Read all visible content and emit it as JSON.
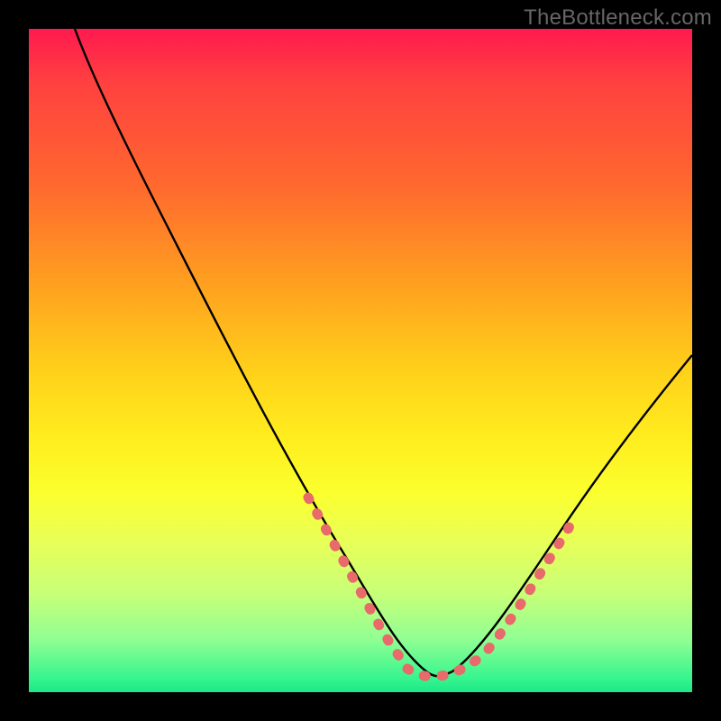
{
  "watermark": "TheBottleneck.com",
  "chart_data": {
    "type": "line",
    "title": "",
    "xlabel": "",
    "ylabel": "",
    "xlim": [
      0,
      100
    ],
    "ylim": [
      0,
      100
    ],
    "series": [
      {
        "name": "curve",
        "x": [
          7,
          12,
          20,
          30,
          40,
          48,
          52,
          56,
          58,
          60,
          62,
          65,
          70,
          80,
          90,
          100
        ],
        "y": [
          100,
          88,
          72,
          50,
          30,
          14,
          7,
          3,
          2,
          2,
          3,
          6,
          12,
          26,
          40,
          54
        ]
      },
      {
        "name": "dotted-segment-left",
        "x": [
          40,
          42,
          44,
          46,
          48,
          50,
          52,
          54,
          56
        ],
        "y": [
          30,
          26,
          22,
          18,
          14,
          10,
          7,
          5,
          3
        ]
      },
      {
        "name": "dotted-segment-bottom",
        "x": [
          56,
          58,
          60,
          62,
          64,
          66,
          68
        ],
        "y": [
          3,
          2,
          2,
          3,
          4,
          5,
          7
        ]
      },
      {
        "name": "dotted-segment-right",
        "x": [
          68,
          70,
          72,
          74,
          76,
          78,
          80
        ],
        "y": [
          9,
          12,
          15,
          18,
          21,
          24,
          26
        ]
      }
    ],
    "colors": {
      "curve": "#000000",
      "dots": "#e86a6a",
      "gradient_stops": [
        "#ff1a4f",
        "#ffa21f",
        "#ffee1f",
        "#91ff93",
        "#1de789"
      ]
    }
  }
}
